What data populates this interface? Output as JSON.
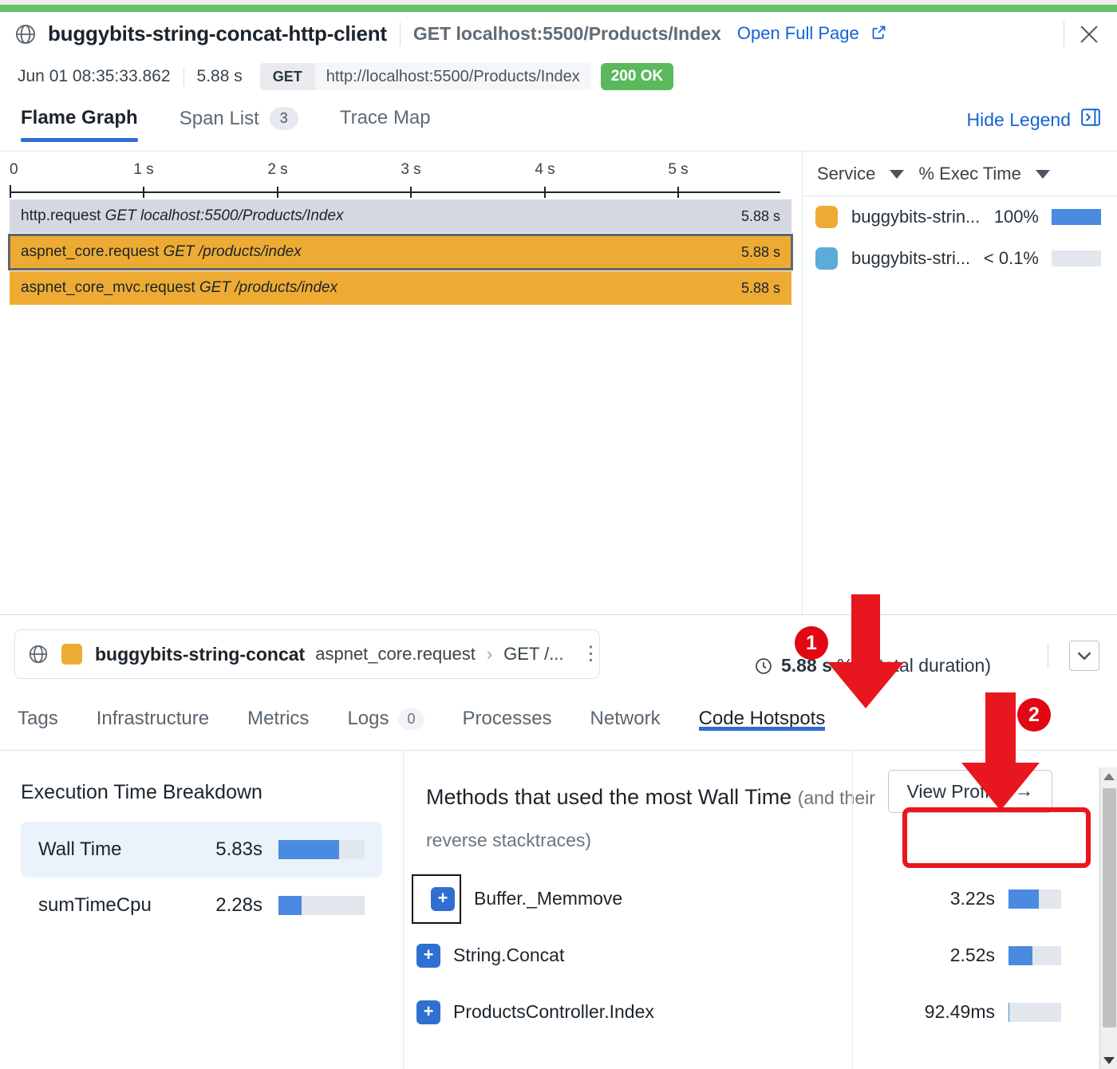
{
  "header": {
    "globe_icon": "globe-icon",
    "title": "buggybits-string-concat-http-client",
    "subtitle": "GET localhost:5500/Products/Index",
    "open_full_page": "Open Full Page",
    "external_link_icon": "external-link-icon",
    "close_icon": "close-icon"
  },
  "meta": {
    "timestamp": "Jun 01 08:35:33.862",
    "duration": "5.88 s",
    "method": "GET",
    "url": "http://localhost:5500/Products/Index",
    "status": "200 OK",
    "status_color": "#5cb85c"
  },
  "tabs": {
    "items": [
      {
        "label": "Flame Graph",
        "count": null,
        "active": true
      },
      {
        "label": "Span List",
        "count": "3",
        "active": false
      },
      {
        "label": "Trace Map",
        "count": null,
        "active": false
      }
    ],
    "hide_legend": "Hide Legend",
    "hide_legend_icon": "panel-collapse-icon"
  },
  "flamegraph": {
    "ticks": [
      "0",
      "1 s",
      "2 s",
      "3 s",
      "4 s",
      "5 s"
    ],
    "spans": [
      {
        "name": "http.request",
        "resource": "GET localhost:5500/Products/Index",
        "duration": "5.88 s",
        "style": "root",
        "width_pct": 100
      },
      {
        "name": "aspnet_core.request",
        "resource": "GET /products/index",
        "duration": "5.88 s",
        "style": "selected",
        "width_pct": 100
      },
      {
        "name": "aspnet_core_mvc.request",
        "resource": "GET /products/index",
        "duration": "5.88 s",
        "style": "orange",
        "width_pct": 100
      }
    ]
  },
  "legend": {
    "col_service": "Service",
    "col_exec": "% Exec Time",
    "rows": [
      {
        "color": "#eeab34",
        "service": "buggybits-strin...",
        "pct": "100%",
        "bar_pct": 100
      },
      {
        "color": "#5bacd8",
        "service": "buggybits-stri...",
        "pct": "< 0.1%",
        "bar_pct": 0
      }
    ]
  },
  "span_detail": {
    "globe_icon": "globe-icon",
    "service_color": "#eeab34",
    "service": "buggybits-string-concat",
    "operation": "aspnet_core.request",
    "chevron": "›",
    "resource": "GET /...",
    "kebab_icon": "kebab-menu-icon",
    "clock_icon": "clock-icon",
    "duration": "5.88 s",
    "duration_suffix": "% of total duration)",
    "collapse_icon": "collapse-panel-icon",
    "tabs": [
      {
        "label": "Tags",
        "count": null,
        "active": false
      },
      {
        "label": "Infrastructure",
        "count": null,
        "active": false
      },
      {
        "label": "Metrics",
        "count": null,
        "active": false
      },
      {
        "label": "Logs",
        "count": "0",
        "active": false
      },
      {
        "label": "Processes",
        "count": null,
        "active": false
      },
      {
        "label": "Network",
        "count": null,
        "active": false
      },
      {
        "label": "Code Hotspots",
        "count": null,
        "active": true
      }
    ]
  },
  "execution_breakdown": {
    "title": "Execution Time Breakdown",
    "rows": [
      {
        "label": "Wall Time",
        "value": "5.83s",
        "bar_pct": 70,
        "highlight": true
      },
      {
        "label": "sumTimeCpu",
        "value": "2.28s",
        "bar_pct": 27,
        "highlight": false
      }
    ]
  },
  "hotspots": {
    "title": "Methods that used the most Wall Time",
    "subtitle": "(and their reverse stacktraces)",
    "view_profile": "View Profile",
    "view_profile_arrow": "→",
    "expand_icon": "expand-plus-icon",
    "methods": [
      {
        "name": "Buffer._Memmove",
        "value": "3.22s",
        "bar_pct": 58,
        "focused": true
      },
      {
        "name": "String.Concat",
        "value": "2.52s",
        "bar_pct": 45,
        "focused": false
      },
      {
        "name": "ProductsController.Index",
        "value": "92.49ms",
        "bar_pct": 2,
        "focused": false
      }
    ]
  },
  "annotations": {
    "marker_color": "#e30613",
    "markers": [
      {
        "number": "1",
        "target": "Code Hotspots tab"
      },
      {
        "number": "2",
        "target": "View Profile button"
      }
    ]
  },
  "scrollbar": {
    "up_icon": "scroll-up-arrow-icon",
    "down_icon": "scroll-down-arrow-icon",
    "thumb": "scrollbar-thumb"
  }
}
